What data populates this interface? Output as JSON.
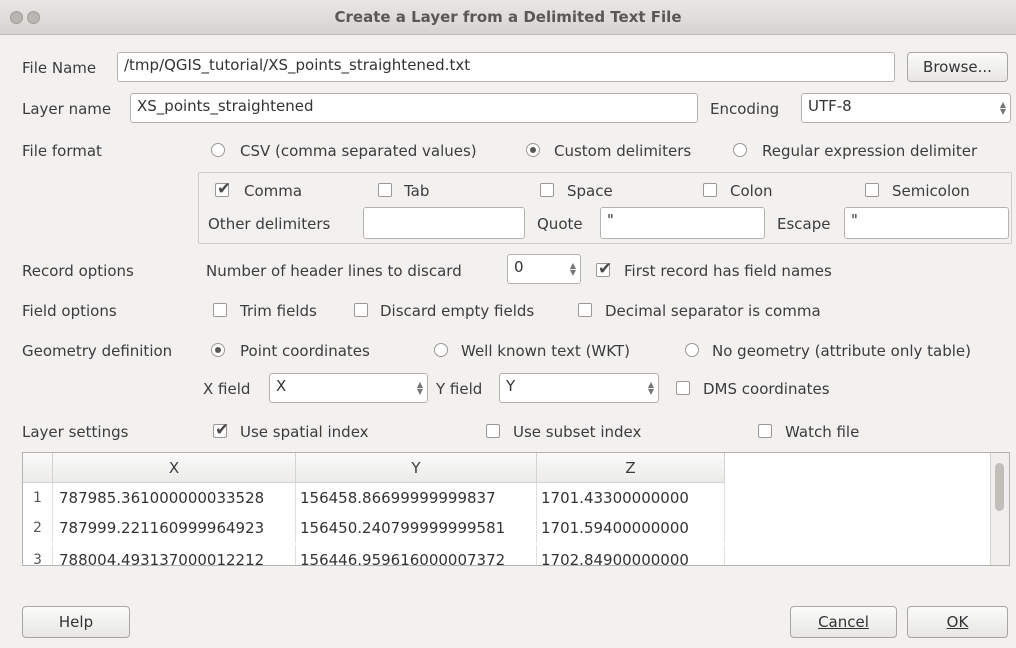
{
  "window": {
    "title": "Create a Layer from a Delimited Text File"
  },
  "file_name": {
    "label": "File Name",
    "value": "/tmp/QGIS_tutorial/XS_points_straightened.txt",
    "browse_label": "Browse..."
  },
  "layer_name": {
    "label": "Layer name",
    "value": "XS_points_straightened",
    "encoding_label": "Encoding",
    "encoding_value": "UTF-8"
  },
  "file_format": {
    "label": "File format",
    "options": [
      {
        "label": "CSV (comma separated values)",
        "selected": false
      },
      {
        "label": "Custom delimiters",
        "selected": true
      },
      {
        "label": "Regular expression delimiter",
        "selected": false
      }
    ]
  },
  "delimiters": {
    "checks": [
      {
        "label": "Comma",
        "checked": true
      },
      {
        "label": "Tab",
        "checked": false
      },
      {
        "label": "Space",
        "checked": false
      },
      {
        "label": "Colon",
        "checked": false
      },
      {
        "label": "Semicolon",
        "checked": false
      }
    ],
    "other_label": "Other delimiters",
    "other_value": "",
    "quote_label": "Quote",
    "quote_value": "\"",
    "escape_label": "Escape",
    "escape_value": "\""
  },
  "record_options": {
    "label": "Record options",
    "header_lines_label": "Number of header lines to discard",
    "header_lines_value": "0",
    "first_record_label": "First record has field names",
    "first_record_checked": true
  },
  "field_options": {
    "label": "Field options",
    "trim_label": "Trim fields",
    "discard_label": "Discard empty fields",
    "decimal_label": "Decimal separator is comma"
  },
  "geometry": {
    "label": "Geometry definition",
    "options": [
      {
        "label": "Point coordinates",
        "selected": true
      },
      {
        "label": "Well known text (WKT)",
        "selected": false
      },
      {
        "label": "No geometry (attribute only table)",
        "selected": false
      }
    ],
    "x_label": "X field",
    "x_value": "X",
    "y_label": "Y field",
    "y_value": "Y",
    "dms_label": "DMS coordinates"
  },
  "layer_settings": {
    "label": "Layer settings",
    "spatial_label": "Use spatial index",
    "spatial_checked": true,
    "subset_label": "Use subset index",
    "watch_label": "Watch file"
  },
  "preview": {
    "columns": [
      "X",
      "Y",
      "Z"
    ],
    "rows": [
      {
        "num": "1",
        "x": "787985.361000000033528",
        "y": "156458.86699999999837",
        "z": "1701.43300000000"
      },
      {
        "num": "2",
        "x": "787999.221160999964923",
        "y": "156450.240799999999581",
        "z": "1701.59400000000"
      },
      {
        "num": "3",
        "x": "788004.493137000012212",
        "y": "156446.959616000007372",
        "z": "1702.84900000000"
      }
    ]
  },
  "buttons": {
    "help": "Help",
    "cancel": "Cancel",
    "ok": "OK"
  }
}
